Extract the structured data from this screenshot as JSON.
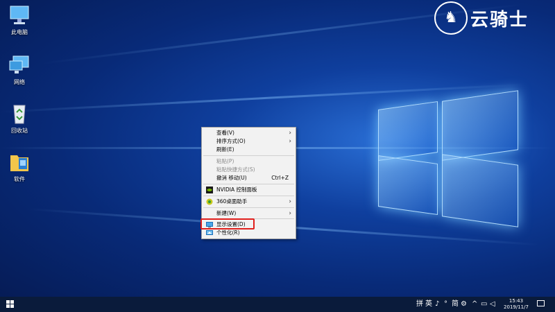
{
  "desktop": {
    "icons": [
      {
        "label": "此电脑",
        "icon": "this-pc-icon"
      },
      {
        "label": "网络",
        "icon": "network-icon"
      },
      {
        "label": "回收站",
        "icon": "recycle-bin-icon"
      },
      {
        "label": "软件",
        "icon": "software-folder-icon"
      }
    ]
  },
  "brand": {
    "text": "云骑士",
    "icon": "knight-logo-icon"
  },
  "context_menu": {
    "items": [
      {
        "label": "查看(V)",
        "submenu": true
      },
      {
        "label": "排序方式(O)",
        "submenu": true
      },
      {
        "label": "刷新(E)"
      },
      {
        "label": "粘贴(P)",
        "disabled": true
      },
      {
        "label": "粘贴快捷方式(S)",
        "disabled": true
      },
      {
        "label": "撤消 移动(U)",
        "shortcut": "Ctrl+Z"
      },
      {
        "label": "NVIDIA 控制面板",
        "icon": "nvidia-icon"
      },
      {
        "label": "360桌面助手",
        "icon": "360-icon",
        "submenu": true
      },
      {
        "label": "新建(W)",
        "submenu": true
      },
      {
        "label": "显示设置(D)",
        "icon": "display-icon",
        "highlighted": true
      },
      {
        "label": "个性化(R)",
        "icon": "personalize-icon"
      }
    ],
    "highlight_color": "#e0201c"
  },
  "taskbar": {
    "tray": [
      "拼",
      "英",
      "♪",
      "°",
      "简",
      "⚙"
    ],
    "time": "15:43",
    "date": "2019/11/7"
  },
  "colors": {
    "taskbar": "#0a1b3b",
    "menu_bg": "#f2f2f2"
  }
}
